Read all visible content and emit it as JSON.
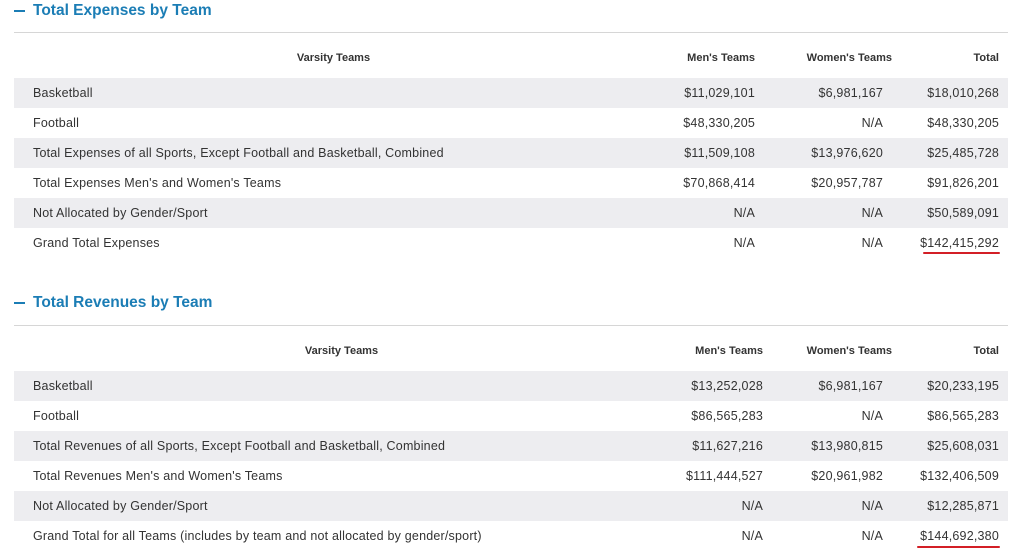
{
  "accent_color": "#1b7db5",
  "highlight_color": "#d31f26",
  "toggle_icon": "minus-icon",
  "expenses": {
    "title": "Total Expenses by Team",
    "headers": [
      "Varsity Teams",
      "Men's Teams",
      "Women's Teams",
      "Total"
    ],
    "rows": [
      [
        "Basketball",
        "$11,029,101",
        "$6,981,167",
        "$18,010,268"
      ],
      [
        "Football",
        "$48,330,205",
        "N/A",
        "$48,330,205"
      ],
      [
        "Total Expenses of all Sports, Except Football and Basketball, Combined",
        "$11,509,108",
        "$13,976,620",
        "$25,485,728"
      ],
      [
        "Total Expenses Men's and Women's Teams",
        "$70,868,414",
        "$20,957,787",
        "$91,826,201"
      ],
      [
        "Not Allocated by Gender/Sport",
        "N/A",
        "N/A",
        "$50,589,091"
      ],
      [
        "Grand Total Expenses",
        "N/A",
        "N/A",
        "$142,415,292"
      ]
    ]
  },
  "revenues": {
    "title": "Total Revenues by Team",
    "headers": [
      "Varsity Teams",
      "Men's Teams",
      "Women's Teams",
      "Total"
    ],
    "rows": [
      [
        "Basketball",
        "$13,252,028",
        "$6,981,167",
        "$20,233,195"
      ],
      [
        "Football",
        "$86,565,283",
        "N/A",
        "$86,565,283"
      ],
      [
        "Total Revenues of all Sports, Except Football and Basketball, Combined",
        "$11,627,216",
        "$13,980,815",
        "$25,608,031"
      ],
      [
        "Total Revenues Men's and Women's Teams",
        "$111,444,527",
        "$20,961,982",
        "$132,406,509"
      ],
      [
        "Not Allocated by Gender/Sport",
        "N/A",
        "N/A",
        "$12,285,871"
      ],
      [
        "Grand Total for all Teams (includes by team and not allocated by gender/sport)",
        "N/A",
        "N/A",
        "$144,692,380"
      ]
    ]
  }
}
